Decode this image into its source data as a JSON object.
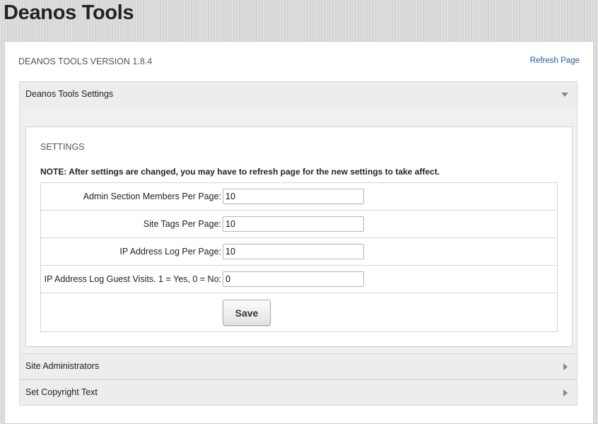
{
  "page": {
    "title": "Deanos Tools"
  },
  "panel": {
    "version": "DEANOS TOOLS VERSION 1.8.4",
    "refresh_label": "Refresh Page"
  },
  "accordion": [
    {
      "label": "Deanos Tools Settings",
      "expanded": true
    },
    {
      "label": "Site Administrators",
      "expanded": false
    },
    {
      "label": "Set Copyright Text",
      "expanded": false
    }
  ],
  "settings": {
    "heading": "SETTINGS",
    "note": "NOTE: After settings are changed, you may have to refresh page for the new settings to take affect.",
    "fields": [
      {
        "label": "Admin Section Members Per Page:",
        "value": "10"
      },
      {
        "label": "Site Tags Per Page:",
        "value": "10"
      },
      {
        "label": "IP Address Log Per Page:",
        "value": "10"
      },
      {
        "label": "IP Address Log Guest Visits. 1 = Yes, 0 = No:",
        "value": "0"
      }
    ],
    "save_label": "Save"
  }
}
